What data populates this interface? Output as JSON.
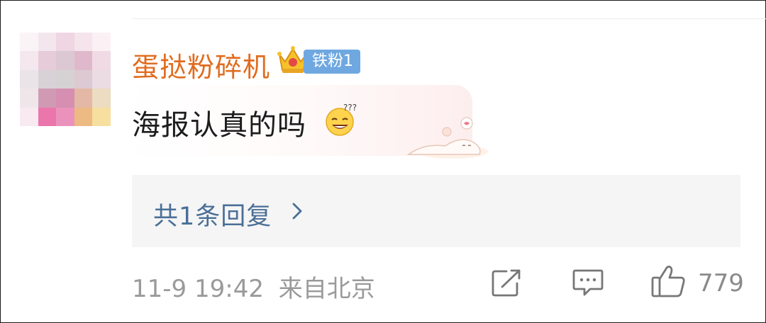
{
  "comment": {
    "username": "蛋挞粉碎机",
    "fan_badge": "铁粉1",
    "text": "海报认真的吗",
    "emoji_icon": "thinking-grin-emoji",
    "sticker_icon": "sleeping-cat-sticker"
  },
  "replies": {
    "label": "共1条回复"
  },
  "meta": {
    "timestamp": "11-9 19:42",
    "location": "来自北京"
  },
  "actions": {
    "like_count": "779"
  },
  "colors": {
    "username": "#e06c1f",
    "badge": "#6fa8e0",
    "reply_link": "#4a6f97",
    "meta_text": "#9a9a9a"
  }
}
